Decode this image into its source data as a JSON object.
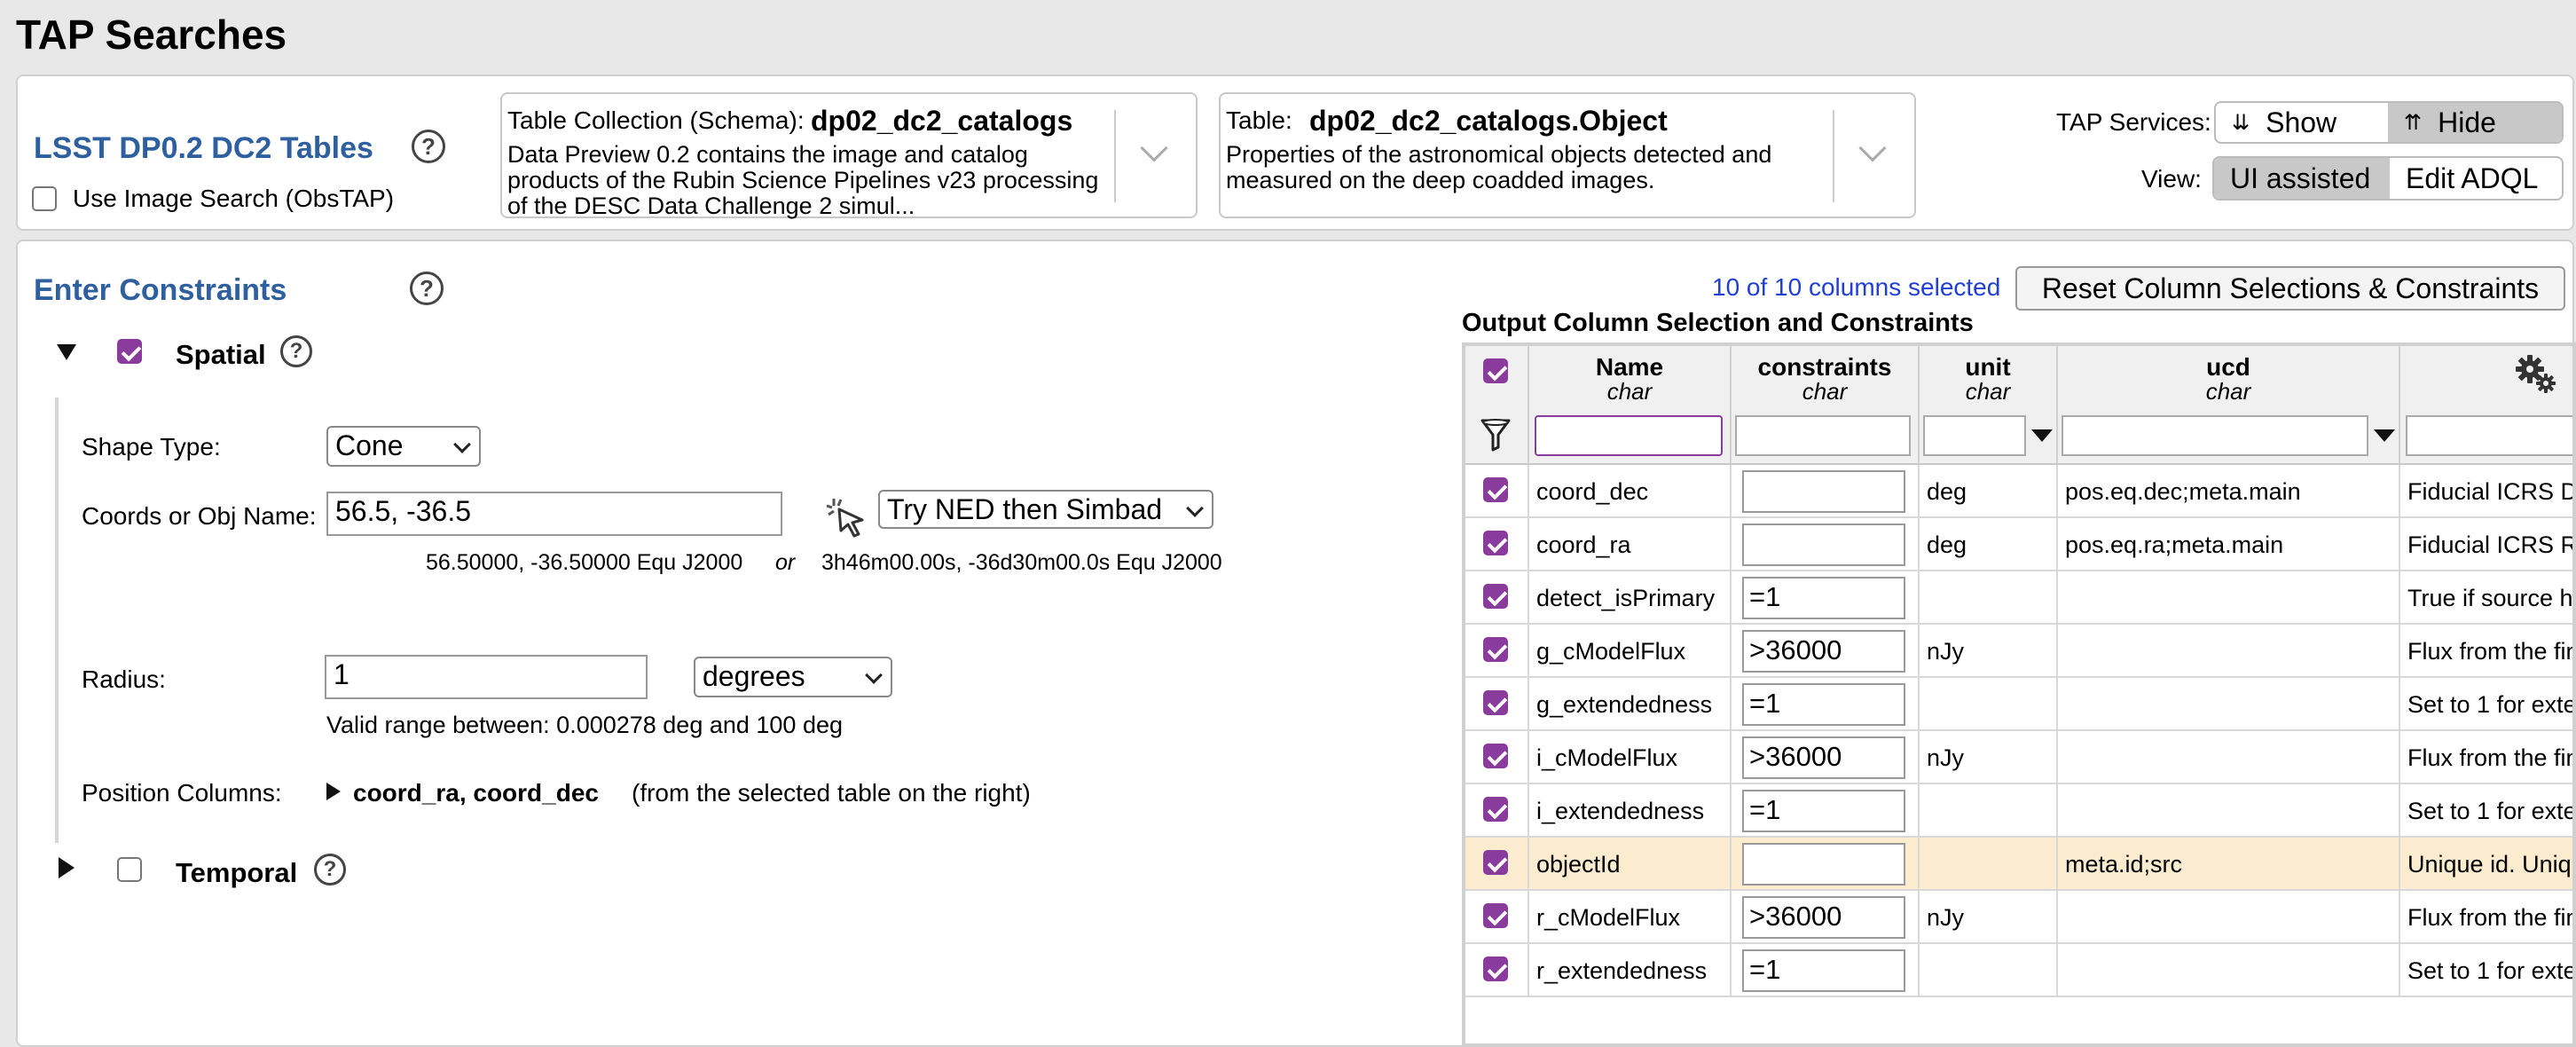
{
  "page_title": "TAP Searches",
  "top": {
    "collection_title": "LSST DP0.2 DC2 Tables",
    "use_image_search": "Use Image Search (ObsTAP)",
    "schema": {
      "label": "Table Collection (Schema):",
      "value": "dp02_dc2_catalogs",
      "desc1": "Data Preview 0.2 contains the image and catalog",
      "desc2": "products of the Rubin Science Pipelines v23 processing",
      "desc3": "of the DESC Data Challenge 2 simul..."
    },
    "table": {
      "label": "Table:",
      "value": "dp02_dc2_catalogs.Object",
      "desc1": "Properties of the astronomical objects detected and",
      "desc2": "measured on the deep coadded images."
    },
    "tap_services_label": "TAP Services:",
    "show_label": "Show",
    "hide_label": "Hide",
    "view_label": "View:",
    "ui_assisted_label": "UI assisted",
    "edit_adql_label": "Edit ADQL"
  },
  "constraints": {
    "title": "Enter Constraints",
    "spatial_label": "Spatial",
    "shape_type_label": "Shape Type:",
    "shape_type_value": "Cone",
    "coords_label": "Coords or Obj Name:",
    "coords_value": "56.5, -36.5",
    "resolver_value": "Try NED then Simbad",
    "coords_decimal": "56.50000, -36.50000  Equ J2000",
    "coords_or": "or",
    "coords_sexagesimal": "3h46m00.00s, -36d30m00.0s  Equ J2000",
    "radius_label": "Radius:",
    "radius_value": "1",
    "radius_unit": "degrees",
    "radius_range": "Valid range between: 0.000278 deg and 100 deg",
    "position_columns_label": "Position Columns:",
    "position_columns_value": "coord_ra, coord_dec",
    "position_columns_note": "(from the selected table on the right)",
    "temporal_label": "Temporal"
  },
  "output": {
    "selected_text": "10 of 10 columns selected",
    "reset_label": "Reset Column Selections & Constraints",
    "heading": "Output Column Selection and Constraints",
    "columns": [
      {
        "name": "Name",
        "type": "char"
      },
      {
        "name": "constraints",
        "type": "char"
      },
      {
        "name": "unit",
        "type": "char"
      },
      {
        "name": "ucd",
        "type": "char"
      }
    ],
    "rows": [
      {
        "name": "coord_dec",
        "constraint": "",
        "unit": "deg",
        "ucd": "pos.eq.dec;meta.main",
        "desc": "Fiducial ICRS D"
      },
      {
        "name": "coord_ra",
        "constraint": "",
        "unit": "deg",
        "ucd": "pos.eq.ra;meta.main",
        "desc": "Fiducial ICRS R"
      },
      {
        "name": "detect_isPrimary",
        "constraint": "=1",
        "unit": "",
        "ucd": "",
        "desc": "True if source h"
      },
      {
        "name": "g_cModelFlux",
        "constraint": ">36000",
        "unit": "nJy",
        "ucd": "",
        "desc": "Flux from the fin"
      },
      {
        "name": "g_extendedness",
        "constraint": "=1",
        "unit": "",
        "ucd": "",
        "desc": "Set to 1 for exte"
      },
      {
        "name": "i_cModelFlux",
        "constraint": ">36000",
        "unit": "nJy",
        "ucd": "",
        "desc": "Flux from the fin"
      },
      {
        "name": "i_extendedness",
        "constraint": "=1",
        "unit": "",
        "ucd": "",
        "desc": "Set to 1 for exte"
      },
      {
        "name": "objectId",
        "constraint": "",
        "unit": "",
        "ucd": "meta.id;src",
        "desc": "Unique id. Uniqu"
      },
      {
        "name": "r_cModelFlux",
        "constraint": ">36000",
        "unit": "nJy",
        "ucd": "",
        "desc": "Flux from the fin"
      },
      {
        "name": "r_extendedness",
        "constraint": "=1",
        "unit": "",
        "ucd": "",
        "desc": "Set to 1 for exte"
      }
    ]
  },
  "colors": {
    "accent_purple": "#8a3c9c",
    "title_blue": "#2e5f9e",
    "link_blue": "#1f3fd6",
    "highlight_row": "#fbeccf"
  }
}
